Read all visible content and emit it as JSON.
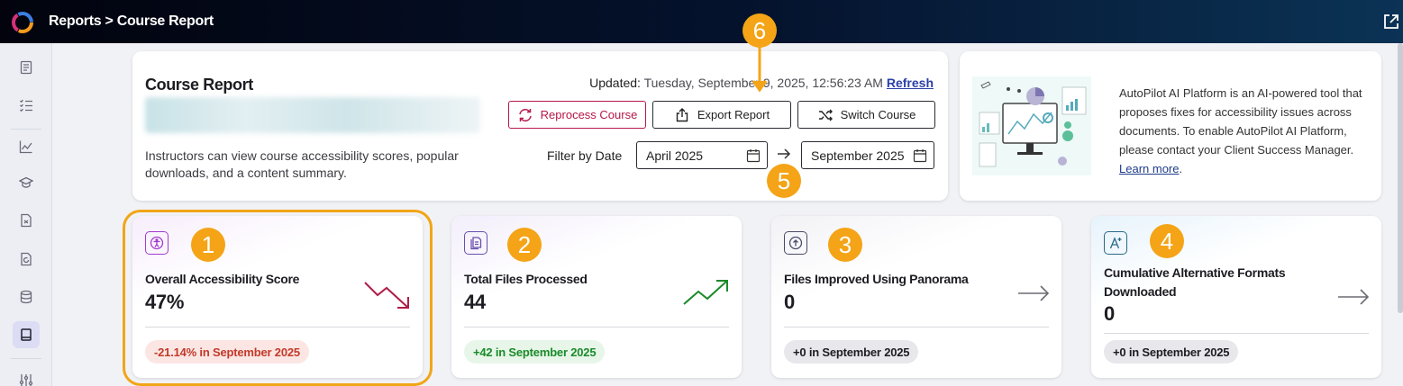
{
  "header": {
    "title": "Reports > Course Report"
  },
  "report": {
    "title": "Course Report",
    "description": "Instructors can view course accessibility scores, popular downloads, and a content summary.",
    "updated_label": "Updated:",
    "updated_time": "Tuesday, September 9, 2025, 12:56:23 AM",
    "refresh_label": "Refresh",
    "buttons": {
      "reprocess": "Reprocess Course",
      "export": "Export Report",
      "switch": "Switch Course"
    },
    "filter_label": "Filter by Date",
    "date_from": "April 2025",
    "date_to": "September 2025"
  },
  "promo": {
    "text": "AutoPilot AI Platform is an AI-powered tool that proposes fixes for accessibility issues across documents. To enable AutoPilot AI Platform, please contact your Client Success Manager.",
    "link": "Learn more",
    "period": "."
  },
  "stats": [
    {
      "label": "Overall Accessibility Score",
      "value": "47%",
      "change": "-21.14% in September 2025",
      "trend": "down"
    },
    {
      "label": "Total Files Processed",
      "value": "44",
      "change": "+42 in September 2025",
      "trend": "up"
    },
    {
      "label": "Files Improved Using Panorama",
      "value": "0",
      "change": "+0 in September 2025",
      "trend": "flat"
    },
    {
      "label_line1": "Cumulative Alternative Formats",
      "label_line2": "Downloaded",
      "value": "0",
      "change": "+0 in September 2025",
      "trend": "flat"
    }
  ],
  "callouts": [
    "1",
    "2",
    "3",
    "4",
    "5",
    "6"
  ],
  "colors": {
    "accent_orange": "#f4a416",
    "danger": "#b6184a",
    "success": "#1b8a2a",
    "link": "#2b3fa8",
    "neutral_arrow": "#6b6b73"
  },
  "icons": {
    "sidebar": [
      "document-list-icon",
      "checklist-icon",
      "line-chart-icon",
      "graduation-cap-icon",
      "file-doc-icon",
      "file-refresh-icon",
      "database-icon",
      "book-icon",
      "sliders-icon"
    ],
    "header": [
      "brand-logo-icon",
      "external-link-icon"
    ],
    "stats": [
      "accessibility-icon",
      "files-icon",
      "upload-circle-icon",
      "ai-sparkle-icon"
    ]
  }
}
